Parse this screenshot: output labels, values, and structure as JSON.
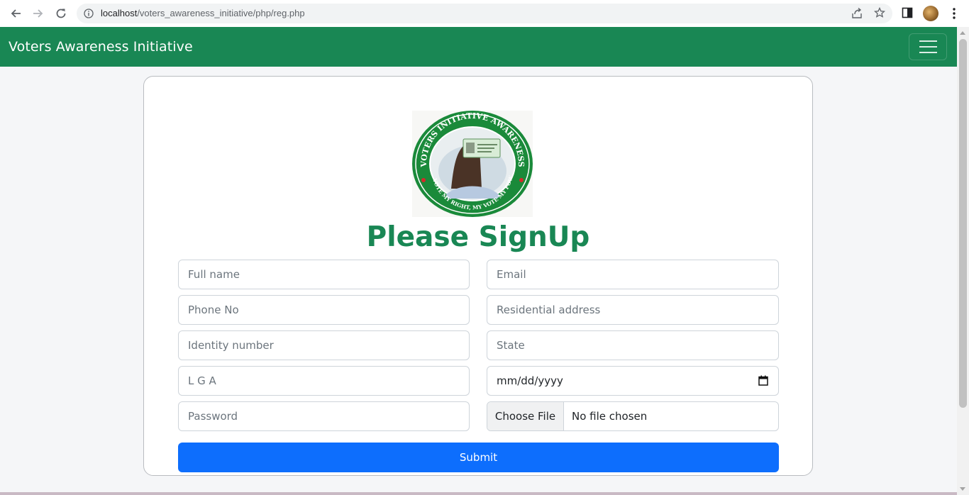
{
  "browser": {
    "url_host": "localhost",
    "url_path": "/voters_awareness_initiative/php/reg.php"
  },
  "navbar": {
    "brand": "Voters Awareness Initiative",
    "bg_color": "#198754"
  },
  "logo": {
    "ring_text_top": "VOTERS INITIATIVE AWARENESS",
    "ring_text_bottom": "MY VOTE MY RIGHT, MY VOTE MY POWER"
  },
  "form": {
    "title": "Please SignUp",
    "fields": {
      "full_name": "Full name",
      "email": "Email",
      "phone": "Phone No",
      "address": "Residential address",
      "identity": "Identity number",
      "state": "State",
      "lga": "L G A",
      "dob": "mm/dd/yyyy",
      "password": "Password"
    },
    "file": {
      "button": "Choose File",
      "status": "No file chosen"
    },
    "submit_label": "Submit",
    "submit_color": "#0d6efd"
  }
}
